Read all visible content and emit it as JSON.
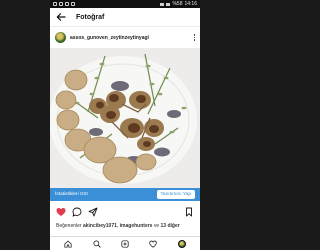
{
  "status_bar": {
    "battery": "%58",
    "time": "14:16"
  },
  "header": {
    "title": "Fotoğraf"
  },
  "post": {
    "username": "assos_gunoven_zeytinzeytinyagi",
    "insights_label": "İstatistikleri Gör",
    "promote_label": "Tanıtımını Yap",
    "likes_prefix": "Beğenenler",
    "likes_user": "akincibey1071",
    "likes_sep": ",",
    "likes_user2": "imagehunters",
    "likes_and": "ve",
    "likes_others": "13 diğer"
  },
  "colors": {
    "accent": "#3b8fd6",
    "like": "#e23a4e"
  },
  "icons": {
    "back": "arrow-left",
    "more": "vertical-dots",
    "like": "heart-filled",
    "comment": "speech-bubble",
    "share": "paper-plane",
    "save": "bookmark",
    "home": "home",
    "search": "magnifier",
    "add": "plus-square",
    "activity": "heart-outline"
  }
}
